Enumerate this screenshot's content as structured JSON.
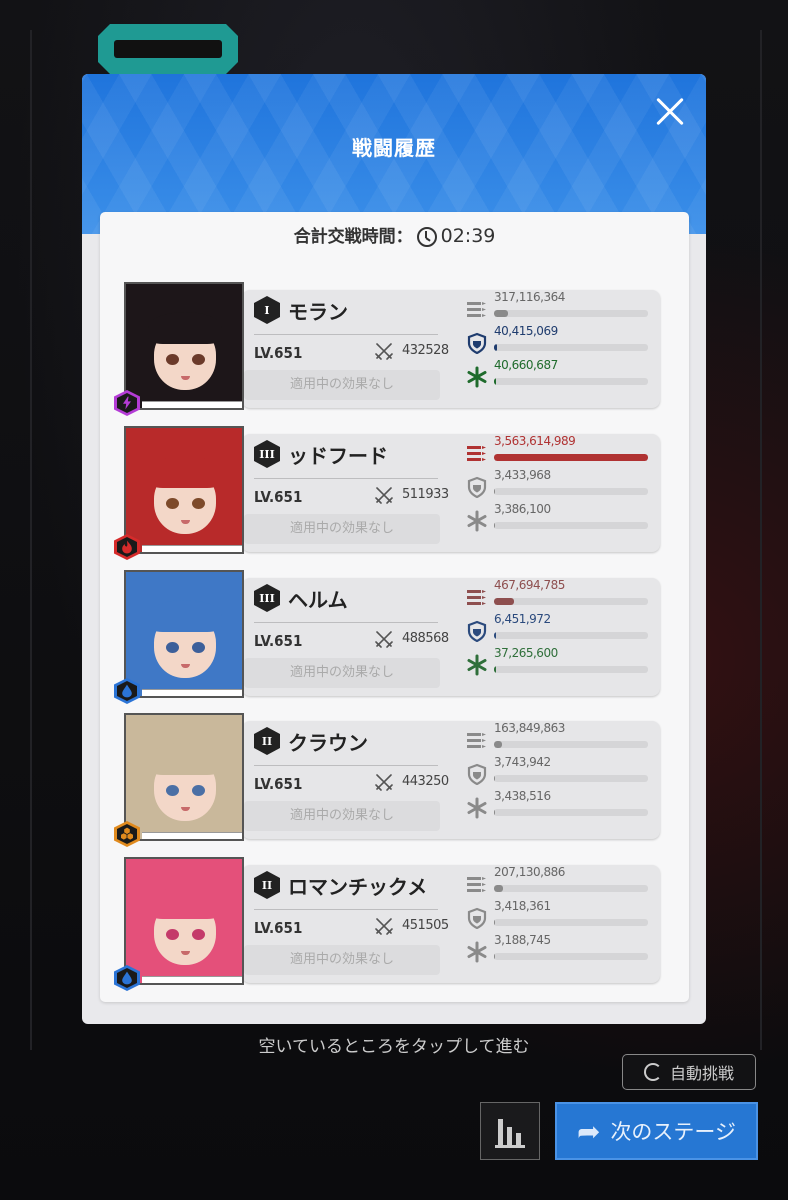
{
  "dialog": {
    "title": "戦闘履歴",
    "total_label": "合計交戦時間：",
    "total_time": "02:39"
  },
  "characters": [
    {
      "name": "モラン",
      "burst": "I",
      "level": "LV.651",
      "power": "432528",
      "effect": "適用中の効果なし",
      "element": "electric",
      "element_color": "#b43cd6",
      "hair_color": "#1d1619",
      "eye_color": "#6b3a2a",
      "stats": [
        {
          "label": "317,116,364",
          "fraction": 0.09,
          "color": "#8a8a8a",
          "type": "damage"
        },
        {
          "label": "40,415,069",
          "fraction": 0.02,
          "color": "#1f3c6e",
          "type": "shield"
        },
        {
          "label": "40,660,687",
          "fraction": 0.01,
          "color": "#1f6b2c",
          "type": "heal"
        }
      ]
    },
    {
      "name": "ッドフード",
      "burst": "III",
      "level": "LV.651",
      "power": "511933",
      "effect": "適用中の効果なし",
      "element": "fire",
      "element_color": "#d62b2b",
      "hair_color": "#b82a2a",
      "eye_color": "#7d4a2a",
      "stats": [
        {
          "label": "3,563,614,989",
          "fraction": 1.0,
          "color": "#b03232",
          "type": "damage"
        },
        {
          "label": "3,433,968",
          "fraction": 0.0,
          "color": "#8a8a8a",
          "type": "shield"
        },
        {
          "label": "3,386,100",
          "fraction": 0.0,
          "color": "#8a8a8a",
          "type": "heal"
        }
      ]
    },
    {
      "name": "ヘルム",
      "burst": "III",
      "level": "LV.651",
      "power": "488568",
      "effect": "適用中の効果なし",
      "element": "water",
      "element_color": "#2b74d6",
      "hair_color": "#3f78c6",
      "eye_color": "#3c5f9a",
      "stats": [
        {
          "label": "467,694,785",
          "fraction": 0.13,
          "color": "#8e4f4f",
          "type": "damage"
        },
        {
          "label": "6,451,972",
          "fraction": 0.01,
          "color": "#2b4a7d",
          "type": "shield"
        },
        {
          "label": "37,265,600",
          "fraction": 0.01,
          "color": "#2f6f3a",
          "type": "heal"
        }
      ]
    },
    {
      "name": "クラウン",
      "burst": "II",
      "level": "LV.651",
      "power": "443250",
      "effect": "適用中の効果なし",
      "element": "iron",
      "element_color": "#e08a1e",
      "hair_color": "#c9b89b",
      "eye_color": "#4a6fa5",
      "stats": [
        {
          "label": "163,849,863",
          "fraction": 0.05,
          "color": "#8a8a8a",
          "type": "damage"
        },
        {
          "label": "3,743,942",
          "fraction": 0.0,
          "color": "#8a8a8a",
          "type": "shield"
        },
        {
          "label": "3,438,516",
          "fraction": 0.0,
          "color": "#8a8a8a",
          "type": "heal"
        }
      ]
    },
    {
      "name": "ロマンチックメ",
      "burst": "II",
      "level": "LV.651",
      "power": "451505",
      "effect": "適用中の効果なし",
      "element": "water",
      "element_color": "#2b74d6",
      "hair_color": "#e4507a",
      "eye_color": "#c43a6a",
      "stats": [
        {
          "label": "207,130,886",
          "fraction": 0.06,
          "color": "#8a8a8a",
          "type": "damage"
        },
        {
          "label": "3,418,361",
          "fraction": 0.0,
          "color": "#8a8a8a",
          "type": "shield"
        },
        {
          "label": "3,188,745",
          "fraction": 0.0,
          "color": "#8a8a8a",
          "type": "heal"
        }
      ]
    }
  ],
  "footer": {
    "hint": "空いているところをタップして進む",
    "auto_label": "自動挑戦",
    "next_label": "次のステージ"
  },
  "icons": {
    "close": "close-icon",
    "clock": "clock-icon",
    "damage": "bullets-icon",
    "shield": "shield-icon",
    "heal": "heal-icon",
    "power": "crossed-swords-icon",
    "refresh": "refresh-icon",
    "stats": "bar-chart-icon",
    "next": "share-arrow-icon"
  }
}
